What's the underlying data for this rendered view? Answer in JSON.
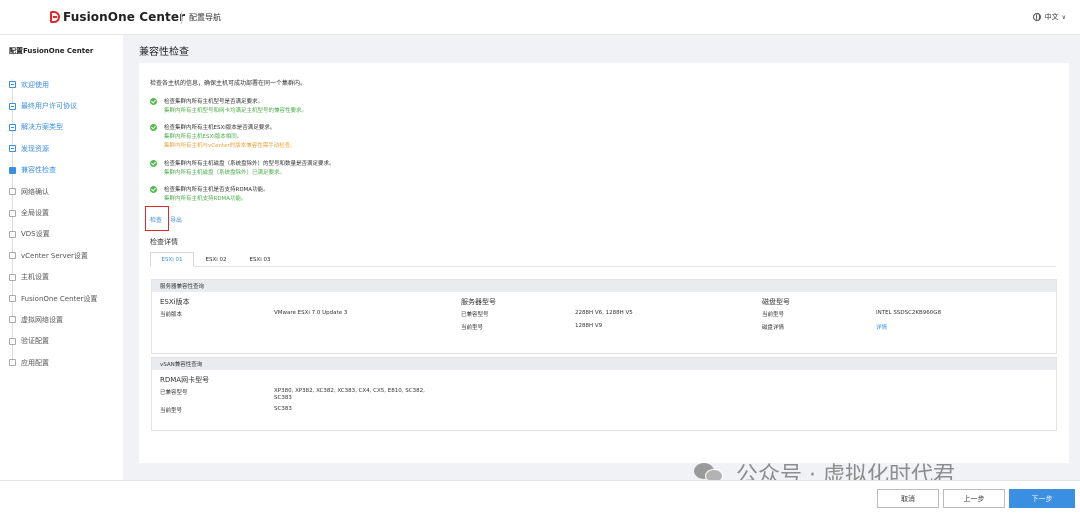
{
  "topbar": {
    "brand": "FusionOne Center",
    "section": "配置导航",
    "language": "中文"
  },
  "sidebar": {
    "title": "配置FusionOne Center",
    "steps": [
      {
        "label": "欢迎使用",
        "state": "done"
      },
      {
        "label": "最终用户许可协议",
        "state": "done"
      },
      {
        "label": "解决方案类型",
        "state": "done"
      },
      {
        "label": "发现资源",
        "state": "done"
      },
      {
        "label": "兼容性检查",
        "state": "current"
      },
      {
        "label": "网络确认",
        "state": "todo"
      },
      {
        "label": "全局设置",
        "state": "todo"
      },
      {
        "label": "VDS设置",
        "state": "todo"
      },
      {
        "label": "vCenter Server设置",
        "state": "todo"
      },
      {
        "label": "主机设置",
        "state": "todo"
      },
      {
        "label": "FusionOne Center设置",
        "state": "todo"
      },
      {
        "label": "虚拟网络设置",
        "state": "todo"
      },
      {
        "label": "验证配置",
        "state": "todo"
      },
      {
        "label": "应用配置",
        "state": "todo"
      }
    ]
  },
  "main": {
    "title": "兼容性检查",
    "intro": "检查各主机的信息，确保主机可成功部署在同一个集群内。",
    "checks": [
      {
        "title": "检查集群内所有主机型号是否满足要求。",
        "lines": [
          {
            "text": "集群内所有主机型号和网卡均满足主机型号的兼容性要求。",
            "color": "green"
          }
        ]
      },
      {
        "title": "检查集群内所有主机ESXi版本是否满足要求。",
        "lines": [
          {
            "text": "集群内所有主机ESXi版本相同。",
            "color": "green"
          },
          {
            "text": "集群内所有主机与vCenter的版本兼容性需手动检查。",
            "color": "orange"
          }
        ]
      },
      {
        "title": "检查集群内所有主机磁盘（系统盘除外）的型号和数量是否满足要求。",
        "lines": [
          {
            "text": "集群内所有主机磁盘（系统盘除外）已满足要求。",
            "color": "green"
          }
        ]
      },
      {
        "title": "检查集群内所有主机是否支持RDMA功能。",
        "lines": [
          {
            "text": "集群内所有主机支持RDMA功能。",
            "color": "green"
          }
        ]
      }
    ],
    "actions": {
      "check": "检查",
      "export": "导出"
    },
    "detail_title": "检查详情",
    "tabs": [
      "ESXi 01",
      "ESXi 02",
      "ESXi 03"
    ],
    "server_panel": {
      "header": "服务器兼容性查询",
      "esxi": {
        "title": "ESXi版本",
        "label": "当前版本",
        "value": "VMware ESXi 7.0 Update 3"
      },
      "server": {
        "title": "服务器型号",
        "compatible_label": "已兼容型号",
        "compatible_value": "2288H V6, 1288H V5",
        "current_label": "当前型号",
        "current_value": "1288H V9"
      },
      "disk": {
        "title": "磁盘型号",
        "current_label": "当前型号",
        "current_value": "INTEL SSDSC2KB960G8",
        "detail_label": "磁盘详情",
        "detail_link": "详情"
      }
    },
    "vsan_panel": {
      "header": "vSAN兼容性查询",
      "title": "RDMA网卡型号",
      "compatible_label": "已兼容型号",
      "compatible_value_1": "XP380, XP382, XC382, XC383, CX4, CX5, E810, SC382,",
      "compatible_value_2": "SC383",
      "current_label": "当前型号",
      "current_value": "SC383"
    }
  },
  "footer": {
    "cancel": "取消",
    "prev": "上一步",
    "next": "下一步"
  },
  "watermark": "公众号 · 虚拟化时代君",
  "colors": {
    "accent": "#3b8fe0",
    "success": "#52b94b",
    "warning": "#e8a33d",
    "brand_red": "#e4262c"
  }
}
